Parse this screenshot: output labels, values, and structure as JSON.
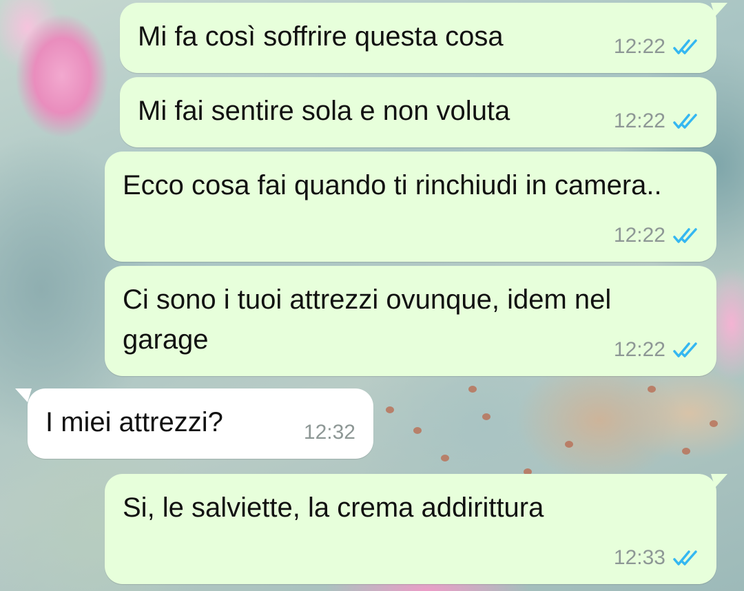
{
  "wallpaper": {
    "description_icon": "cactus-flower-wallpaper"
  },
  "colors": {
    "outgoing_bubble": "#e7ffdb",
    "incoming_bubble": "#ffffff",
    "read_ticks": "#34b7f1",
    "timestamp": "#8d9795"
  },
  "messages": [
    {
      "direction": "outgoing",
      "text": "Mi fa così soffrire questa cosa",
      "time": "12:22",
      "status": "read",
      "status_icon": "double-check-read-icon"
    },
    {
      "direction": "outgoing",
      "text": "Mi fai sentire sola e non voluta",
      "time": "12:22",
      "status": "read",
      "status_icon": "double-check-read-icon"
    },
    {
      "direction": "outgoing",
      "text": "Ecco cosa fai quando ti rinchiudi in camera..",
      "time": "12:22",
      "status": "read",
      "status_icon": "double-check-read-icon"
    },
    {
      "direction": "outgoing",
      "text": "Ci sono i tuoi attrezzi ovunque, idem nel garage",
      "time": "12:22",
      "status": "read",
      "status_icon": "double-check-read-icon"
    },
    {
      "direction": "incoming",
      "text": "I miei attrezzi?",
      "time": "12:32"
    },
    {
      "direction": "outgoing",
      "text": "Si, le salviette, la crema addirittura",
      "time": "12:33",
      "status": "read",
      "status_icon": "double-check-read-icon"
    }
  ]
}
